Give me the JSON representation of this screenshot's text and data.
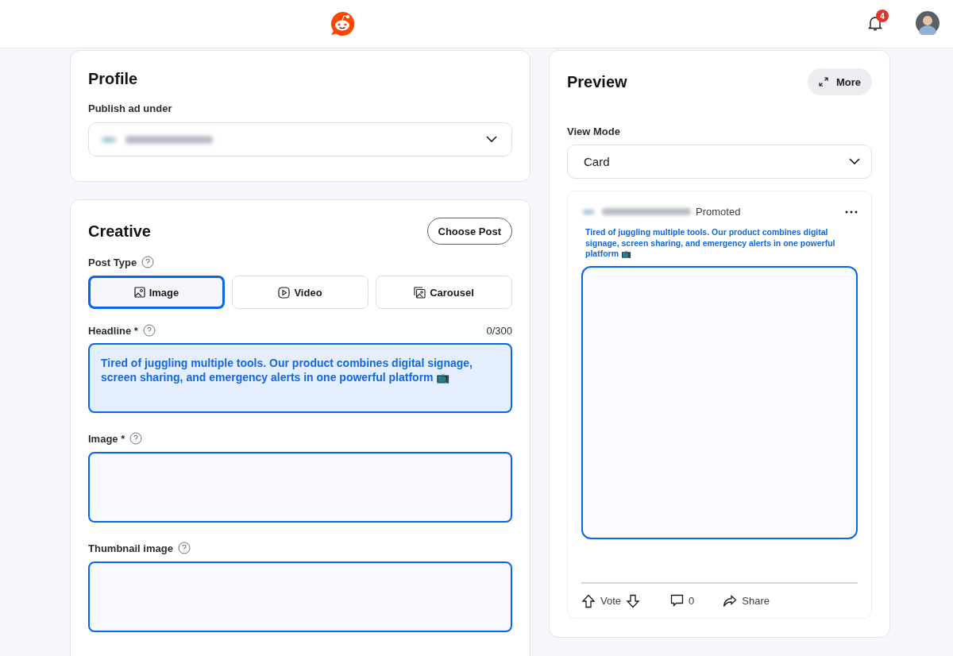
{
  "header": {
    "notification_count": "4"
  },
  "profile": {
    "title": "Profile",
    "publish_label": "Publish ad under"
  },
  "creative": {
    "title": "Creative",
    "choose_post": "Choose Post",
    "post_type_label": "Post Type",
    "post_types": [
      {
        "kind": "image",
        "label": "Image",
        "selected": true
      },
      {
        "kind": "video",
        "label": "Video",
        "selected": false
      },
      {
        "kind": "carousel",
        "label": "Carousel",
        "selected": false
      }
    ],
    "headline": {
      "label": "Headline *",
      "counter": "0/300",
      "value": "Tired of juggling multiple tools. Our product combines digital signage, screen sharing, and emergency alerts in one powerful platform 📺"
    },
    "image_label": "Image *",
    "thumbnail_label": "Thumbnail image"
  },
  "preview": {
    "title": "Preview",
    "more": "More",
    "view_mode_label": "View Mode",
    "view_mode": "Card",
    "post": {
      "promoted": "Promoted",
      "headline": "Tired of juggling multiple tools. Our product combines digital signage, screen sharing, and emergency alerts in one powerful platform 📺",
      "vote": "Vote",
      "comments": "0",
      "share": "Share"
    }
  }
}
